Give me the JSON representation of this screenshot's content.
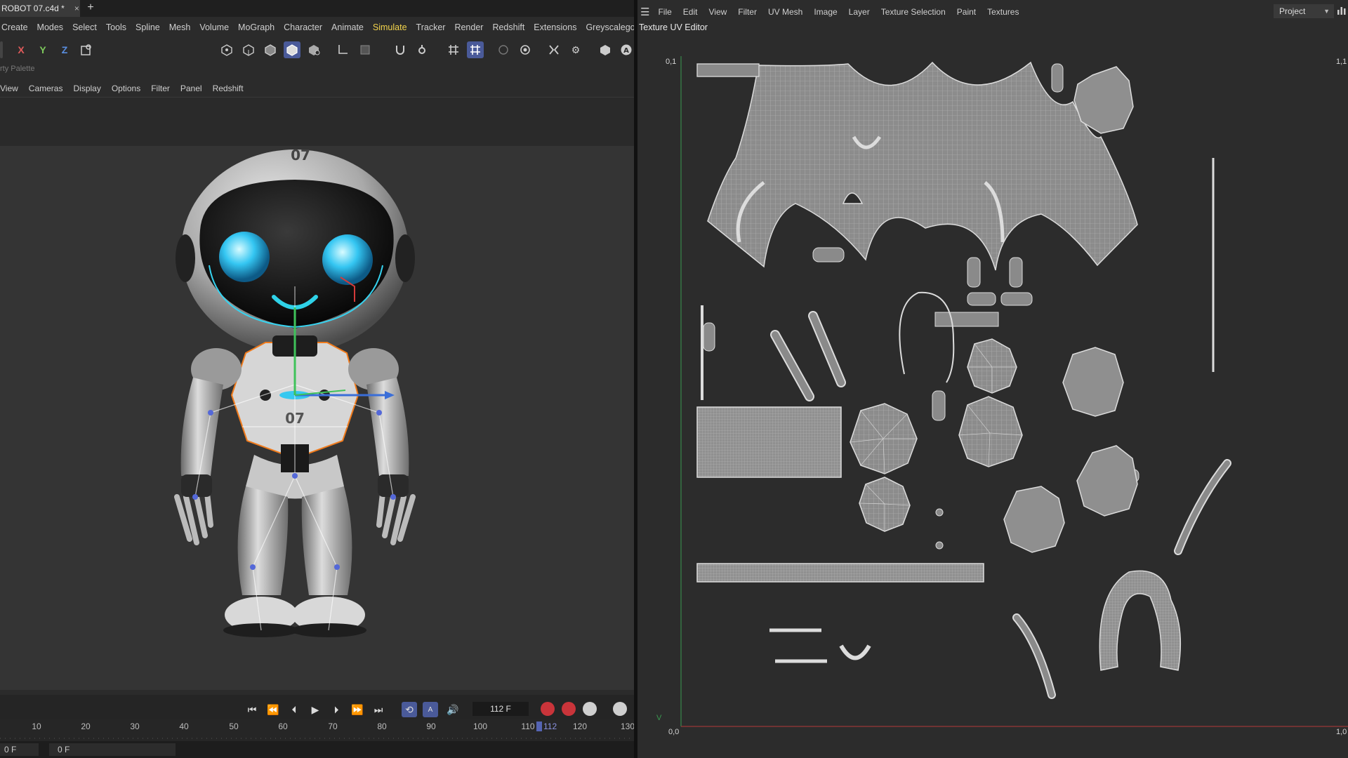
{
  "app": {
    "doc_tab_title": "ROBOT 07.c4d *",
    "close_glyph": "×",
    "new_tab_glyph": "+"
  },
  "menubar": [
    "Create",
    "Modes",
    "Select",
    "Tools",
    "Spline",
    "Mesh",
    "Volume",
    "MoGraph",
    "Character",
    "Animate",
    "Simulate",
    "Tracker",
    "Render",
    "Redshift",
    "Extensions",
    "Greyscalegorilla"
  ],
  "menubar_active": "Simulate",
  "toolbar": {
    "axis_x": "X",
    "axis_y": "Y",
    "axis_z": "Z",
    "accent": "#4a5a99"
  },
  "palette_label": "rty Palette",
  "viewport_menu": [
    "View",
    "Cameras",
    "Display",
    "Options",
    "Filter",
    "Panel",
    "Redshift"
  ],
  "robot": {
    "visor_label": "07",
    "chest_label": "07"
  },
  "timeline": {
    "current_frame": "112 F",
    "ticks": [
      "10",
      "20",
      "30",
      "40",
      "50",
      "60",
      "70",
      "80",
      "90",
      "100",
      "110",
      "120",
      "130"
    ],
    "playhead_label": "112",
    "status_start": "0 F",
    "status_end": "0 F"
  },
  "uv_editor": {
    "menu": [
      "File",
      "Edit",
      "View",
      "Filter",
      "UV Mesh",
      "Image",
      "Layer",
      "Texture Selection",
      "Paint",
      "Textures"
    ],
    "project_label": "Project",
    "title": "Texture UV Editor",
    "coord_top_left": "0,1",
    "coord_top_right": "1,1",
    "coord_bottom_left": "0,0",
    "coord_bottom_right": "1,0",
    "axis_v": "V",
    "axis_color": "#3a9a50",
    "axis_u_color": "#b33a3a"
  }
}
